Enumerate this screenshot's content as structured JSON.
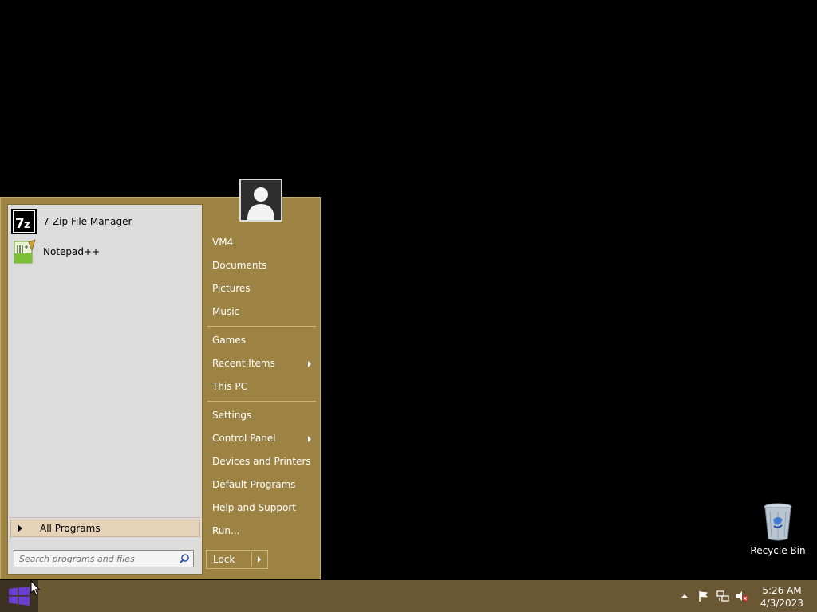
{
  "desktop": {
    "recycle_bin_label": "Recycle Bin"
  },
  "start_menu": {
    "pinned": [
      {
        "label": "7-Zip File Manager",
        "icon": "7zip-icon"
      },
      {
        "label": "Notepad++",
        "icon": "notepad-plus-plus-icon"
      }
    ],
    "all_programs_label": "All Programs",
    "search_placeholder": "Search programs and files",
    "search_value": "",
    "right_items": [
      {
        "label": "VM4",
        "has_submenu": false
      },
      {
        "label": "Documents",
        "has_submenu": false
      },
      {
        "label": "Pictures",
        "has_submenu": false
      },
      {
        "label": "Music",
        "has_submenu": false
      },
      {
        "label": "Games",
        "has_submenu": false
      },
      {
        "label": "Recent Items",
        "has_submenu": true
      },
      {
        "label": "This PC",
        "has_submenu": false
      },
      {
        "label": "Settings",
        "has_submenu": false
      },
      {
        "label": "Control Panel",
        "has_submenu": true
      },
      {
        "label": "Devices and Printers",
        "has_submenu": false
      },
      {
        "label": "Default Programs",
        "has_submenu": false
      },
      {
        "label": "Help and Support",
        "has_submenu": false
      },
      {
        "label": "Run...",
        "has_submenu": false
      }
    ],
    "lock_label": "Lock"
  },
  "taskbar": {
    "clock_time": "5:26 AM",
    "clock_date": "4/3/2023",
    "tray_icons": [
      "show-hidden-icons-icon",
      "action-center-flag-icon",
      "network-icon",
      "volume-muted-icon"
    ]
  },
  "colors": {
    "menu_bg": "#9c8343",
    "left_pane_bg": "#dcdcdc",
    "taskbar_bg": "#6a5733",
    "start_button_logo": "#6b3fd1"
  }
}
